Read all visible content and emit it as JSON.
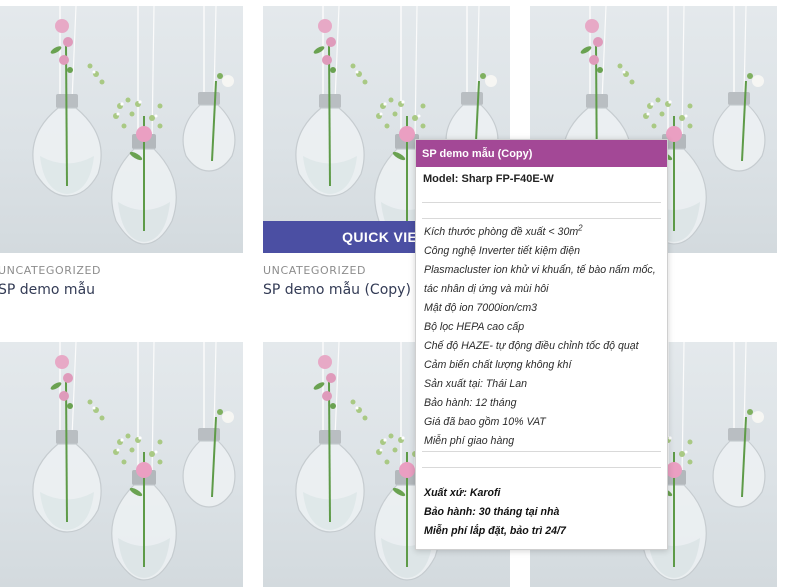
{
  "products": [
    {
      "category": "UNCATEGORIZED",
      "title": "SP demo mẫu"
    },
    {
      "category": "UNCATEGORIZED",
      "title": "SP demo mẫu (Copy)"
    }
  ],
  "quick_view_label": "QUICK VIEW",
  "popup": {
    "title": "SP demo mẫu (Copy)",
    "model": "Model: Sharp FP-F40E-W",
    "room_size": "Kích thước phòng đề xuất < 30m",
    "room_size_sup": "2",
    "specs": [
      "Công nghệ Inverter tiết kiệm điện",
      "Plasmacluster ion khử vi khuẩn, tế bào nấm mốc,",
      "tác nhân dị ứng và mùi hôi",
      "Mật độ ion 7000ion/cm3",
      "Bộ lọc HEPA cao cấp",
      "Chế độ HAZE- tự động điều chỉnh tốc độ quạt",
      "Cảm biến chất lượng không khí",
      "Sản xuất tại: Thái Lan",
      "Bảo hành: 12 tháng",
      "Giá đã bao gồm 10% VAT",
      "Miễn phí giao hàng"
    ],
    "extra": [
      "Xuất xứ: Karofi",
      "Bảo hành: 30 tháng tại nhà",
      "Miễn phí lắp đặt, bảo trì 24/7"
    ]
  },
  "colors": {
    "popup_header": "#a34896",
    "quick_view": "#4b4fa3",
    "title_text": "#333b55"
  }
}
